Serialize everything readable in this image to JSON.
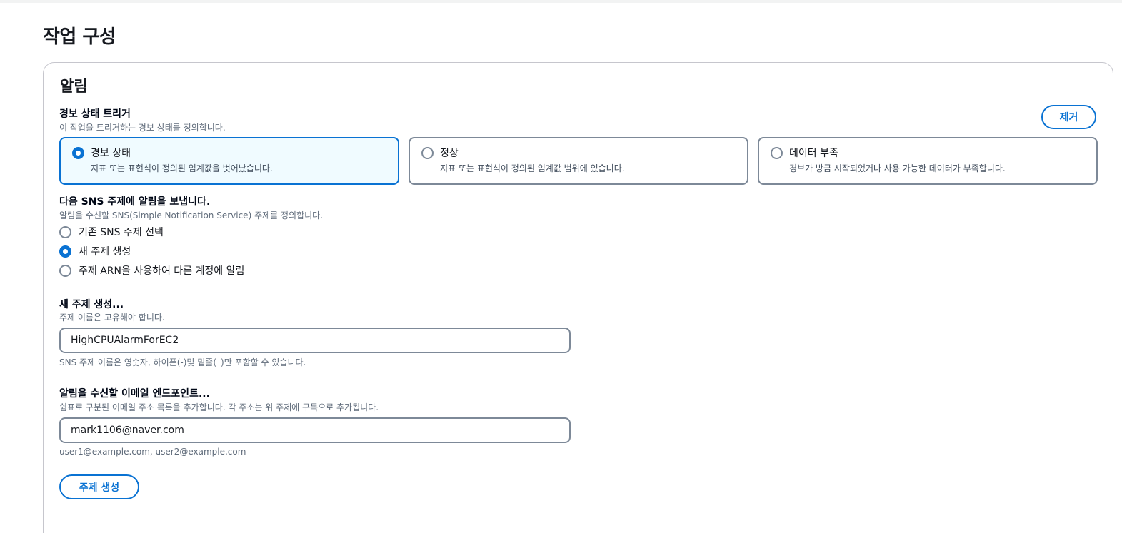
{
  "page": {
    "title": "작업 구성"
  },
  "notification": {
    "section_title": "알림",
    "remove_label": "제거",
    "trigger": {
      "label": "경보 상태 트리거",
      "description": "이 작업을 트리거하는 경보 상태를 정의합니다.",
      "options": [
        {
          "label": "경보 상태",
          "description": "지표 또는 표현식이 정의된 임계값을 벗어났습니다.",
          "selected": true
        },
        {
          "label": "정상",
          "description": "지표 또는 표현식이 정의된 임계값 범위에 있습니다.",
          "selected": false
        },
        {
          "label": "데이터 부족",
          "description": "경보가 방금 시작되었거나 사용 가능한 데이터가 부족합니다.",
          "selected": false
        }
      ]
    },
    "sns": {
      "label": "다음 SNS 주제에 알림을 보냅니다.",
      "description": "알림을 수신할 SNS(Simple Notification Service) 주제를 정의합니다.",
      "options": [
        {
          "label": "기존 SNS 주제 선택",
          "selected": false
        },
        {
          "label": "새 주제 생성",
          "selected": true
        },
        {
          "label": "주제 ARN을 사용하여 다른 계정에 알림",
          "selected": false
        }
      ]
    },
    "new_topic": {
      "label": "새 주제 생성...",
      "description": "주제 이름은 고유해야 합니다.",
      "value": "HighCPUAlarmForEC2",
      "hint": "SNS 주제 이름은 영숫자, 하이픈(-)및 밑줄(_)만 포함할 수 있습니다."
    },
    "email": {
      "label": "알림을 수신할 이메일 엔드포인트...",
      "description": "쉼표로 구분된 이메일 주소 목록을 추가합니다. 각 주소는 위 주제에 구독으로 추가됩니다.",
      "value": "mark1106@naver.com",
      "hint": "user1@example.com, user2@example.com"
    },
    "create_topic_label": "주제 생성"
  },
  "colors": {
    "accent": "#0972d3",
    "selected_tile_bg": "#f0fbff",
    "border": "#7d8998",
    "muted_text": "#5f6b7a"
  }
}
